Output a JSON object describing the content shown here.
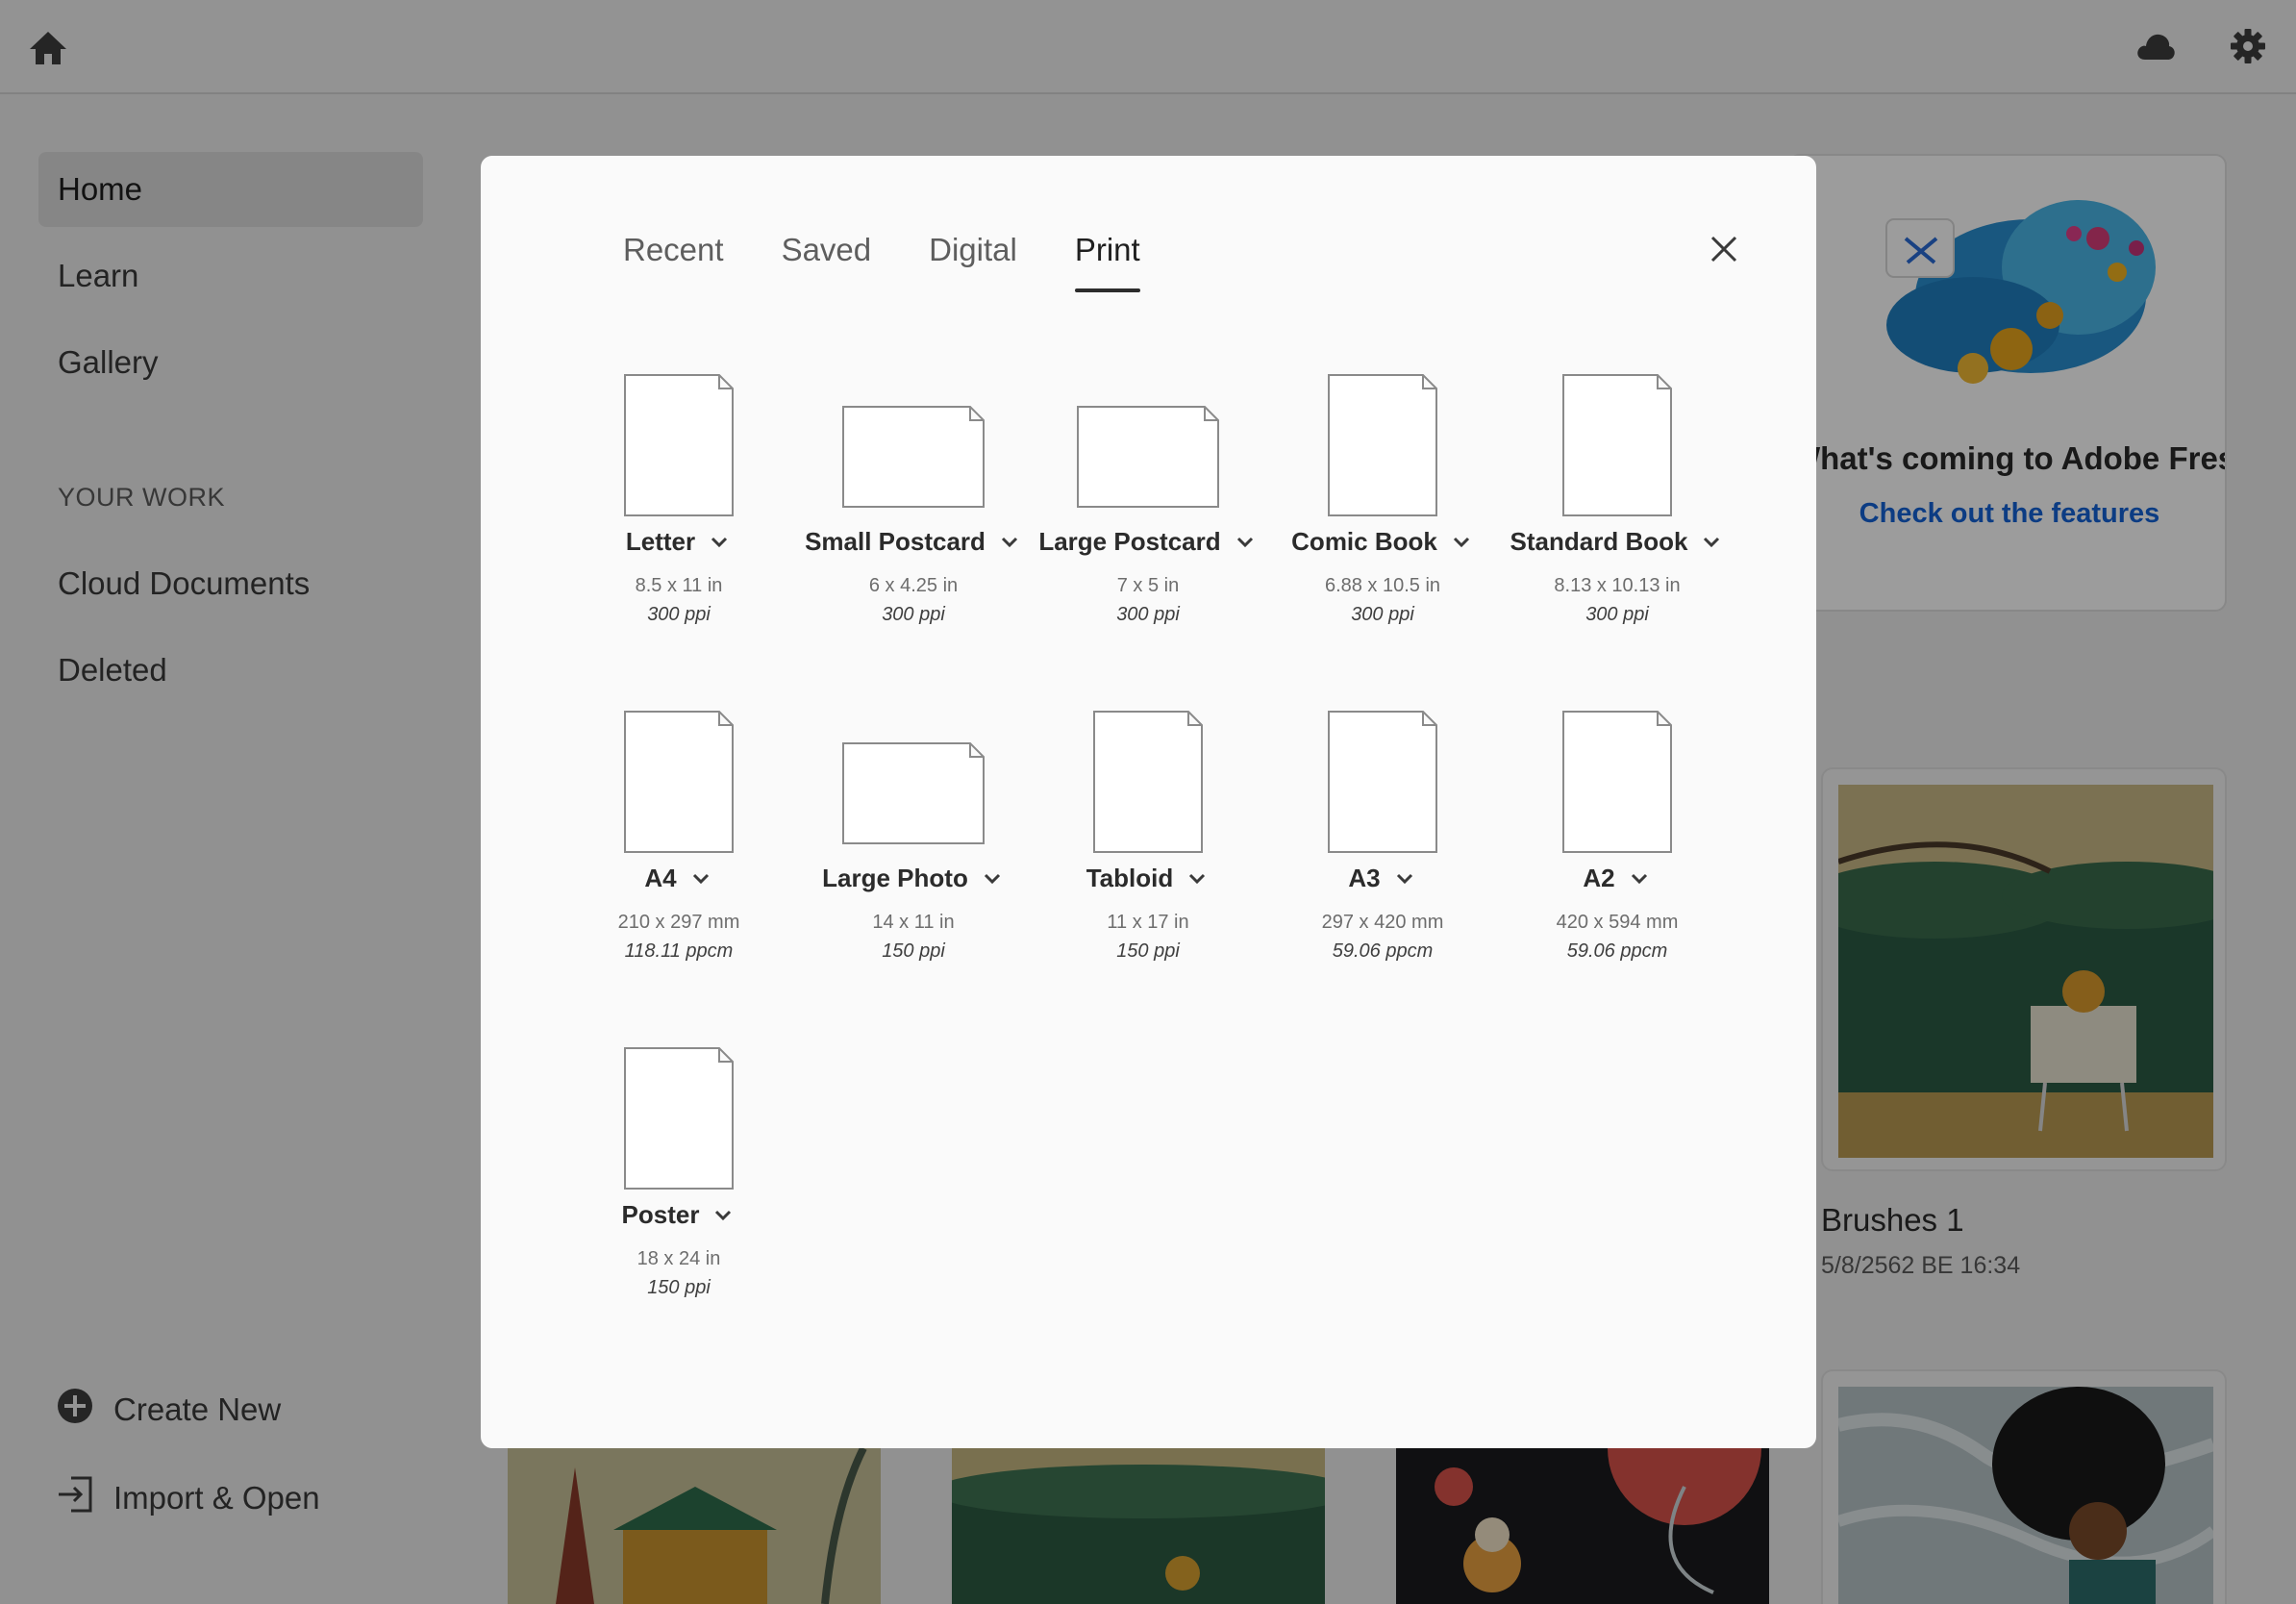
{
  "topbar": {
    "home_icon": "home-icon",
    "cloud_icon": "cloud-icon",
    "settings_icon": "gear-icon"
  },
  "sidebar": {
    "items": [
      {
        "label": "Home",
        "active": true
      },
      {
        "label": "Learn"
      },
      {
        "label": "Gallery"
      }
    ],
    "section_title": "YOUR WORK",
    "work_items": [
      {
        "label": "Cloud Documents"
      },
      {
        "label": "Deleted"
      }
    ],
    "actions": [
      {
        "label": "Create New",
        "icon": "plus-circle-icon"
      },
      {
        "label": "Import & Open",
        "icon": "import-icon"
      }
    ]
  },
  "promo": {
    "title": "What's coming to Adobe Fresco",
    "link": "Check out the features"
  },
  "recent_docs": [
    {
      "title": "Brushes 1",
      "date": "5/8/2562 BE 16:34"
    }
  ],
  "dialog": {
    "tabs": [
      {
        "label": "Recent"
      },
      {
        "label": "Saved"
      },
      {
        "label": "Digital"
      },
      {
        "label": "Print",
        "active": true
      }
    ],
    "close_icon": "close-icon",
    "presets": [
      {
        "name": "Letter",
        "size": "8.5 x 11 in",
        "res": "300 ppi",
        "orientation": "portrait"
      },
      {
        "name": "Small Postcard",
        "size": "6 x 4.25 in",
        "res": "300 ppi",
        "orientation": "landscape"
      },
      {
        "name": "Large Postcard",
        "size": "7 x 5 in",
        "res": "300 ppi",
        "orientation": "landscape"
      },
      {
        "name": "Comic Book",
        "size": "6.88 x 10.5 in",
        "res": "300 ppi",
        "orientation": "portrait"
      },
      {
        "name": "Standard Book",
        "size": "8.13 x 10.13 in",
        "res": "300 ppi",
        "orientation": "portrait"
      },
      {
        "name": "A4",
        "size": "210 x 297 mm",
        "res": "118.11 ppcm",
        "orientation": "portrait"
      },
      {
        "name": "Large Photo",
        "size": "14 x 11 in",
        "res": "150 ppi",
        "orientation": "landscape"
      },
      {
        "name": "Tabloid",
        "size": "11 x 17 in",
        "res": "150 ppi",
        "orientation": "portrait"
      },
      {
        "name": "A3",
        "size": "297 x 420 mm",
        "res": "59.06 ppcm",
        "orientation": "portrait"
      },
      {
        "name": "A2",
        "size": "420 x 594 mm",
        "res": "59.06 ppcm",
        "orientation": "portrait"
      },
      {
        "name": "Poster",
        "size": "18 x 24 in",
        "res": "150 ppi",
        "orientation": "portrait"
      }
    ]
  }
}
